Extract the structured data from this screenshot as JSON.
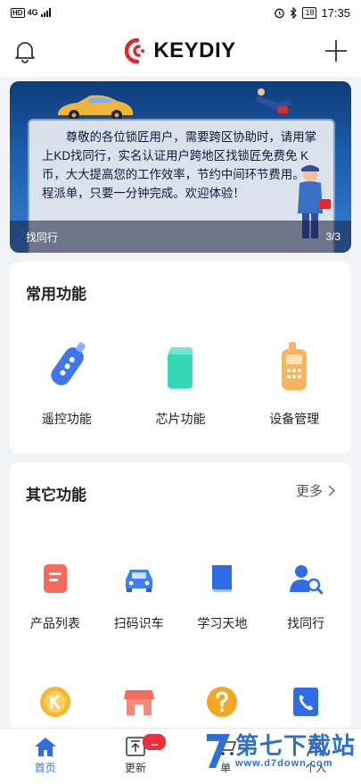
{
  "status_bar": {
    "network": "4G",
    "hd": "HD",
    "battery": "18",
    "time": "17:35"
  },
  "header": {
    "logo_text": "KEYDIY"
  },
  "banner": {
    "notice": "尊敬的各位锁匠用户，需要跨区协助时，请用掌上KD找同行，实名认证用户跨地区找锁匠免费免 K币，大大提高您的工作效率，节约中间环节费用。远程派单，只要一分钟完成。欢迎体验！",
    "caption": "找同行",
    "pager": "3/3"
  },
  "common": {
    "title": "常用功能",
    "items": [
      {
        "label": "遥控功能",
        "icon": "remote-key-icon"
      },
      {
        "label": "芯片功能",
        "icon": "chip-icon"
      },
      {
        "label": "设备管理",
        "icon": "device-icon"
      }
    ]
  },
  "other": {
    "title": "其它功能",
    "more": "更多",
    "items": [
      {
        "label": "产品列表",
        "icon": "product-list-icon"
      },
      {
        "label": "扫码识车",
        "icon": "scan-car-icon"
      },
      {
        "label": "学习天地",
        "icon": "book-icon"
      },
      {
        "label": "找同行",
        "icon": "find-peer-icon"
      }
    ],
    "row2_icons": [
      "k-coin-icon",
      "store-icon",
      "help-icon",
      "phone-icon"
    ]
  },
  "tabbar": {
    "tabs": [
      {
        "label": "首页",
        "icon": "home-icon"
      },
      {
        "label": "更新",
        "icon": "update-icon",
        "badge": "..."
      },
      {
        "label": "单",
        "icon": "cart-icon"
      },
      {
        "label": "个人",
        "icon": "person-icon"
      }
    ]
  },
  "watermark": {
    "text": "第七下载站",
    "url": "www.d7down.com"
  },
  "colors": {
    "accent": "#2f6de6",
    "brand_red": "#e02a2a",
    "badge": "#e8303e"
  }
}
